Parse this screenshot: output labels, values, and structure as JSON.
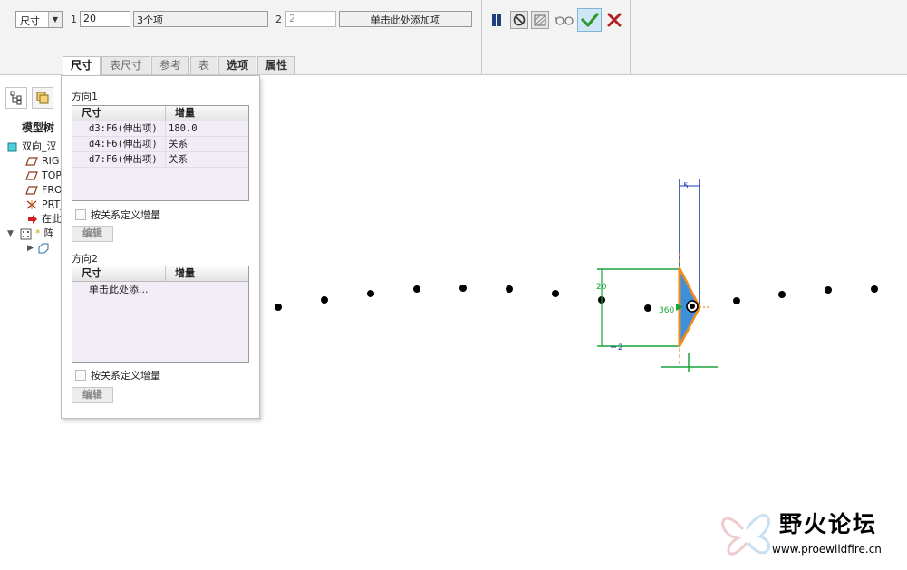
{
  "dashboard": {
    "pattern_type": "尺寸",
    "dir1_number": "1",
    "dir1_count": "20",
    "dir1_items": "3个项",
    "dir2_number": "2",
    "dir2_count": "2",
    "dir2_add_items": "单击此处添加项"
  },
  "tabs": [
    {
      "label": "尺寸",
      "active": true
    },
    {
      "label": "表尺寸"
    },
    {
      "label": "参考"
    },
    {
      "label": "表"
    },
    {
      "label": "选项"
    },
    {
      "label": "属性"
    }
  ],
  "model_tree": {
    "title": "模型树",
    "items": [
      "双向_汊",
      "RIG",
      "TOP",
      "FRO",
      "PRT_",
      "在此",
      "阵",
      ""
    ]
  },
  "dimensions_panel": {
    "direction1": {
      "title": "方向1",
      "col_dimension": "尺寸",
      "col_increment": "增量",
      "rows": [
        {
          "dim": "d3:F6(伸出项)",
          "inc": "180.0"
        },
        {
          "dim": "d4:F6(伸出项)",
          "inc": "关系"
        },
        {
          "dim": "d7:F6(伸出项)",
          "inc": "关系"
        }
      ],
      "define_by_relation": "按关系定义增量",
      "edit": "编辑"
    },
    "direction2": {
      "title": "方向2",
      "col_dimension": "尺寸",
      "col_increment": "增量",
      "add_hint": "单击此处添...",
      "define_by_relation": "按关系定义增量",
      "edit": "编辑"
    }
  },
  "graphics": {
    "dim_angle": "360",
    "dim_height": "20",
    "dim_bottom": "2",
    "dim_top": "5",
    "pattern_point_count": 14
  },
  "watermark": {
    "name": "野火论坛",
    "url": "www.proewildfire.cn"
  },
  "colors": {
    "dimension_green": "#19a43a",
    "dimension_blue": "#1a3fb0",
    "feature_fill": "#3f8fd8",
    "feature_outline": "#f08a1e",
    "ok_green": "#2d9a2d",
    "cancel_red": "#b52020"
  },
  "icons": [
    "pause-icon",
    "no-preview-icon",
    "geometry-preview-icon",
    "glasses-icon",
    "checkmark-icon",
    "cancel-x-icon",
    "model-tree-icon",
    "layers-icon",
    "part-icon",
    "datum-plane-icon",
    "csys-icon",
    "insert-arrow-icon",
    "pattern-icon",
    "expand-arrow-icon"
  ]
}
